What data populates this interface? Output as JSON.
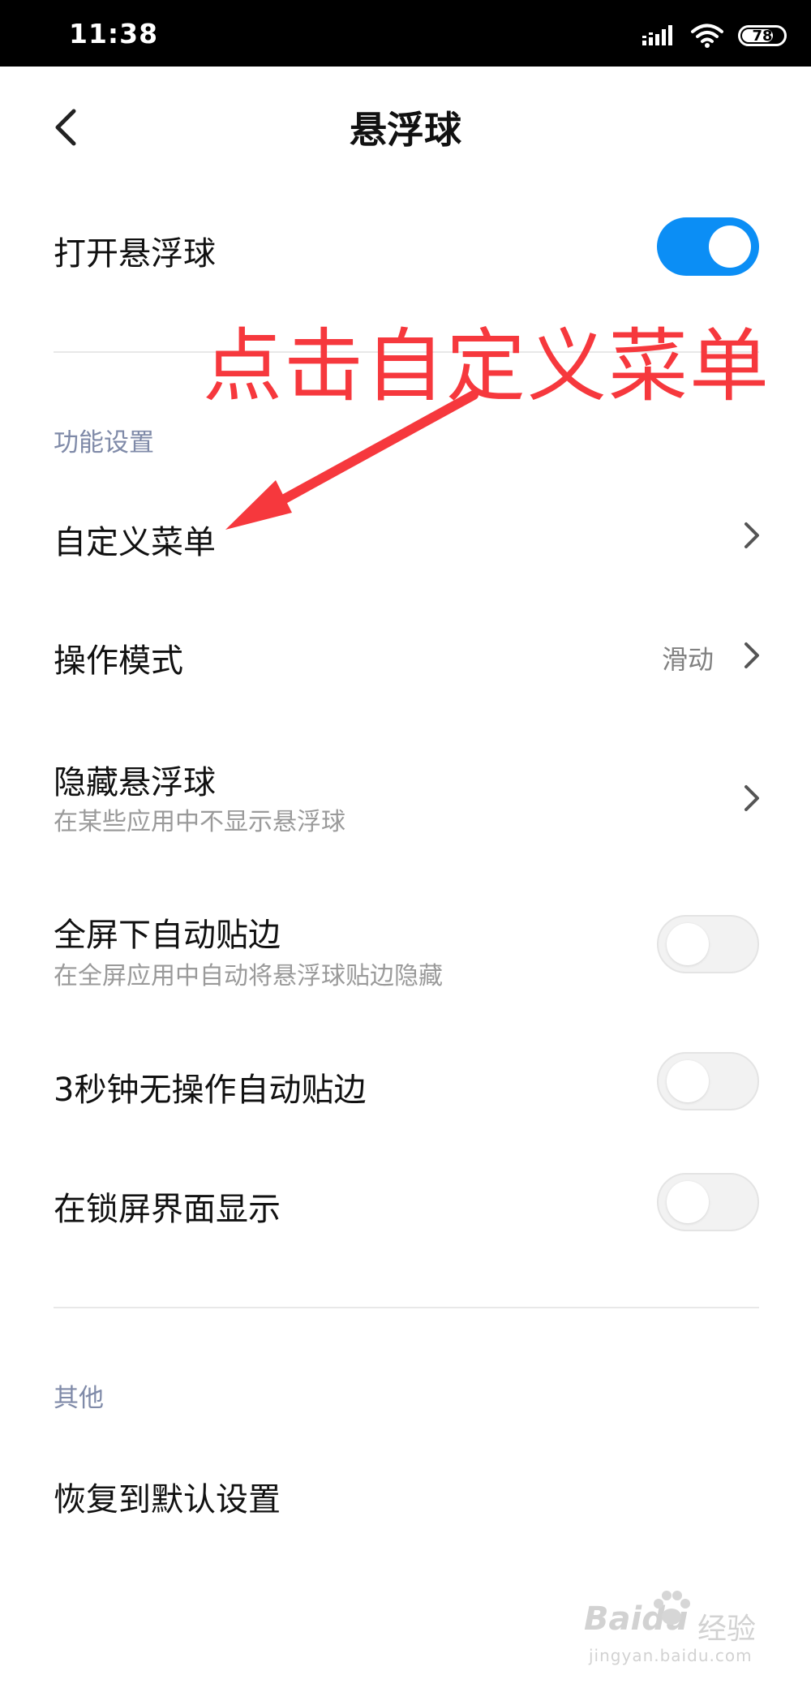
{
  "status_bar": {
    "time": "11:38",
    "battery_level": "78",
    "icons": [
      "signal-icon",
      "wifi-icon",
      "battery-icon"
    ]
  },
  "header": {
    "title": "悬浮球",
    "back_icon": "chevron-left-icon"
  },
  "main_toggle": {
    "label": "打开悬浮球",
    "enabled": true
  },
  "sections": {
    "features": {
      "header": "功能设置",
      "items": [
        {
          "title": "自定义菜单",
          "subtitle": "",
          "value": "",
          "control": "chevron"
        },
        {
          "title": "操作模式",
          "subtitle": "",
          "value": "滑动",
          "control": "chevron"
        },
        {
          "title": "隐藏悬浮球",
          "subtitle": "在某些应用中不显示悬浮球",
          "value": "",
          "control": "chevron"
        },
        {
          "title": "全屏下自动贴边",
          "subtitle": "在全屏应用中自动将悬浮球贴边隐藏",
          "value": "",
          "control": "toggle",
          "enabled": false
        },
        {
          "title": "3秒钟无操作自动贴边",
          "subtitle": "",
          "value": "",
          "control": "toggle",
          "enabled": false
        },
        {
          "title": "在锁屏界面显示",
          "subtitle": "",
          "value": "",
          "control": "toggle",
          "enabled": false
        }
      ]
    },
    "other": {
      "header": "其他",
      "items": [
        {
          "title": "恢复到默认设置"
        }
      ]
    }
  },
  "annotation": {
    "text": "点击自定义菜单",
    "color": "#f6383d"
  },
  "watermark": {
    "brand": "Baidu",
    "sub": "经验",
    "url": "jingyan.baidu.com"
  },
  "colors": {
    "accent": "#0b8ef5",
    "section_header": "#7f8aa8",
    "subtitle": "#9a9a9a",
    "status_bar": "#000000"
  }
}
